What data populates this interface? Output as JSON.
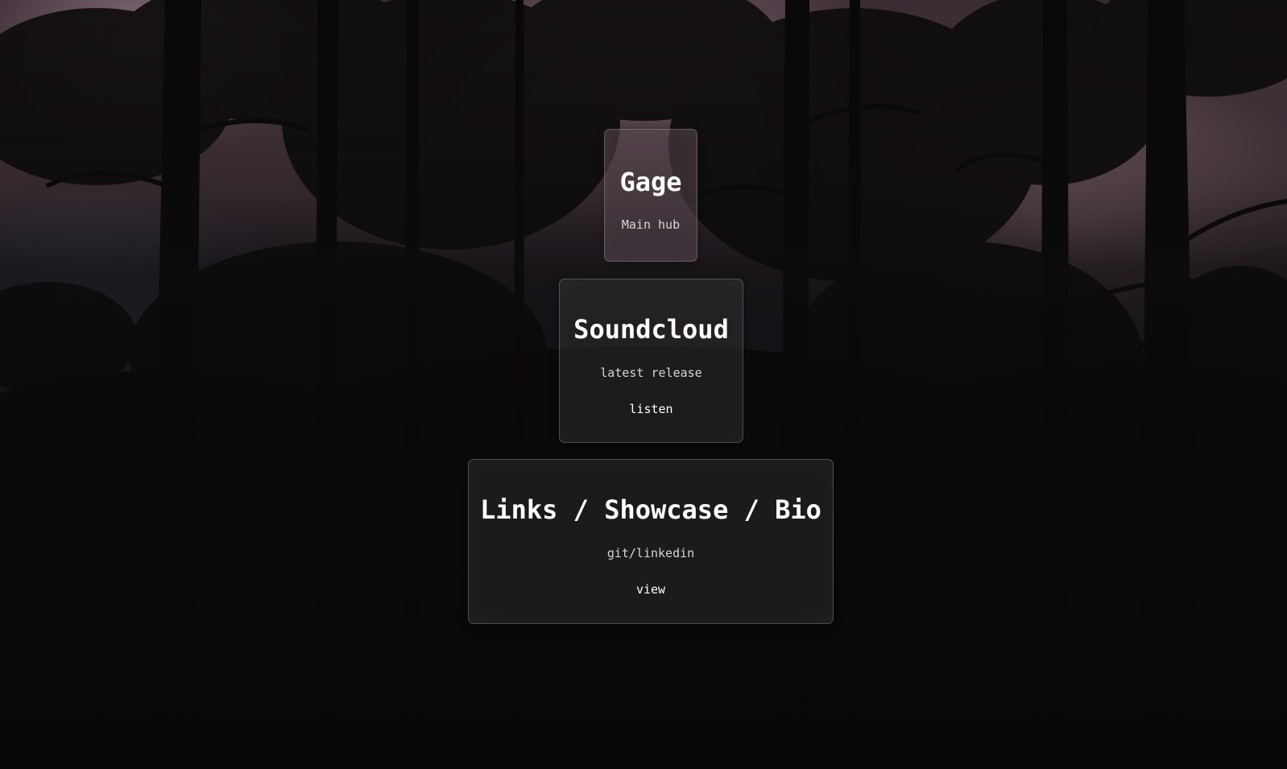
{
  "background": {
    "description_icon": "forest-dusk-background",
    "sky_colors": [
      "#c39aa8",
      "#8f8fb5",
      "#6f7fa8"
    ],
    "tree_color": "#0c0a0b"
  },
  "cards": {
    "gage": {
      "title": "Gage",
      "subtitle": "Main hub"
    },
    "soundcloud": {
      "title": "Soundcloud",
      "subtitle": "latest release",
      "button_label": "listen"
    },
    "links": {
      "title": "Links / Showcase / Bio",
      "subtitle": "git/linkedin",
      "button_label": "view"
    }
  }
}
